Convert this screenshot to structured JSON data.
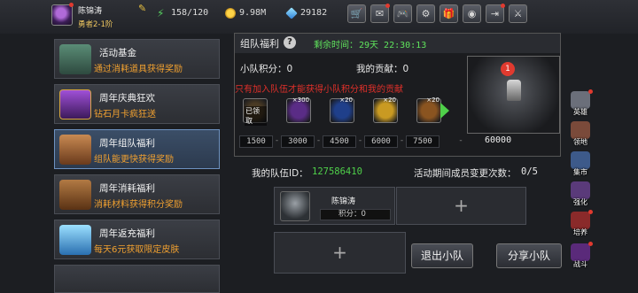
{
  "player": {
    "name": "陈锦涛",
    "rank": "勇者2-1阶"
  },
  "resources": {
    "stamina": "158/120",
    "gold": "9.98M",
    "gems": "29182"
  },
  "toolbar": {
    "buttons": [
      "cart",
      "mail",
      "gamepad",
      "gear",
      "gift",
      "palette",
      "exit",
      "swords"
    ]
  },
  "sidebar": {
    "items": [
      {
        "title": "活动基金",
        "desc": "通过消耗道具获得奖励",
        "icon": "bag-icon"
      },
      {
        "title": "周年庆典狂欢",
        "desc": "钻石月卡疯狂送",
        "icon": "card-icon"
      },
      {
        "title": "周年组队福利",
        "desc": "组队能更快获得奖励",
        "icon": "chest-icon"
      },
      {
        "title": "周年消耗福利",
        "desc": "消耗材料获得积分奖励",
        "icon": "treasure-icon"
      },
      {
        "title": "周年返充福利",
        "desc": "每天6元获取限定皮肤",
        "icon": "crystal-icon"
      }
    ]
  },
  "panel": {
    "title": "组队福利",
    "timer_label": "剩余时间：",
    "timer_value": "29天 22:30:13",
    "score_label": "小队积分：0",
    "contrib_label": "我的贡献：0",
    "notice": "只有加入队伍才能获得小队积分和我的贡献",
    "rewards": [
      {
        "count": "",
        "stamp": "已领取",
        "color": "#4a3a24"
      },
      {
        "count": "×300",
        "stamp": "",
        "color": "#5a2c86"
      },
      {
        "count": "×20",
        "stamp": "",
        "color": "#1f3f8a"
      },
      {
        "count": "×20",
        "stamp": "",
        "color": "#c99a22"
      },
      {
        "count": "×20",
        "stamp": "",
        "color": "#8a5420"
      }
    ],
    "milestones": [
      "1500",
      "3000",
      "4500",
      "6000",
      "7500"
    ],
    "final_milestone": "60000",
    "boss_badge": "1"
  },
  "team": {
    "id_label": "我的队伍ID：",
    "id": "127586410",
    "changes_label": "活动期间成员变更次数：",
    "changes_value": "0/5",
    "member": {
      "name": "陈锦涛",
      "score_label": "积分：0"
    },
    "plus": "+",
    "leave_button": "退出小队",
    "share_button": "分享小队"
  },
  "right_nav": {
    "items": [
      {
        "label": "英雄",
        "color": "#6b6f7a",
        "badge": true
      },
      {
        "label": "领地",
        "color": "#7a4a3a",
        "badge": false
      },
      {
        "label": "集市",
        "color": "#3d5a8a",
        "badge": false
      },
      {
        "label": "强化",
        "color": "#5a3a7a",
        "badge": false
      },
      {
        "label": "培养",
        "color": "#8a2a2a",
        "badge": true
      },
      {
        "label": "战斗",
        "color": "#5a2a7a",
        "badge": true
      }
    ]
  }
}
